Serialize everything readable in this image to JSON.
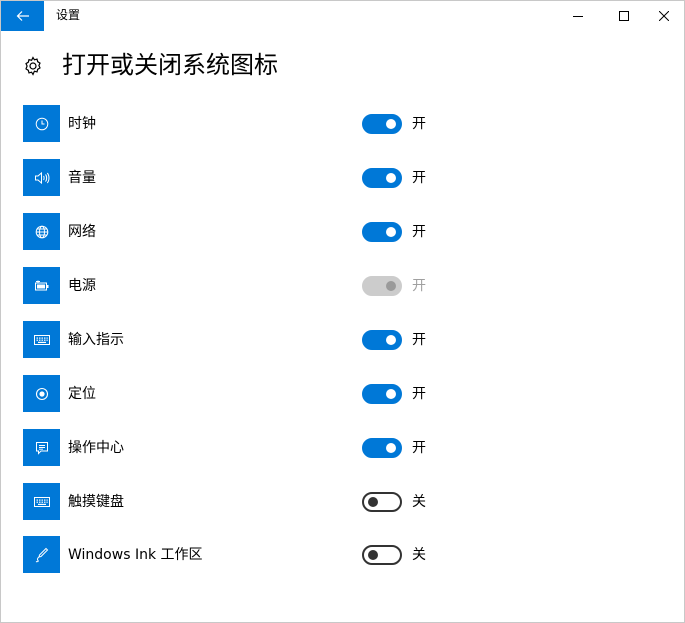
{
  "window": {
    "title": "设置"
  },
  "page": {
    "title": "打开或关闭系统图标"
  },
  "colors": {
    "accent": "#0078d7",
    "disabled": "#cccccc",
    "text": "#000000"
  },
  "items": [
    {
      "label": "时钟",
      "state": "开",
      "on": true,
      "enabled": true,
      "icon": "clock-icon"
    },
    {
      "label": "音量",
      "state": "开",
      "on": true,
      "enabled": true,
      "icon": "volume-icon"
    },
    {
      "label": "网络",
      "state": "开",
      "on": true,
      "enabled": true,
      "icon": "globe-icon"
    },
    {
      "label": "电源",
      "state": "开",
      "on": true,
      "enabled": false,
      "icon": "battery-icon"
    },
    {
      "label": "输入指示",
      "state": "开",
      "on": true,
      "enabled": true,
      "icon": "keyboard-icon"
    },
    {
      "label": "定位",
      "state": "开",
      "on": true,
      "enabled": true,
      "icon": "location-icon"
    },
    {
      "label": "操作中心",
      "state": "开",
      "on": true,
      "enabled": true,
      "icon": "action-center-icon"
    },
    {
      "label": "触摸键盘",
      "state": "关",
      "on": false,
      "enabled": true,
      "icon": "touch-keyboard-icon"
    },
    {
      "label": "Windows Ink 工作区",
      "state": "关",
      "on": false,
      "enabled": true,
      "icon": "pen-icon"
    }
  ]
}
